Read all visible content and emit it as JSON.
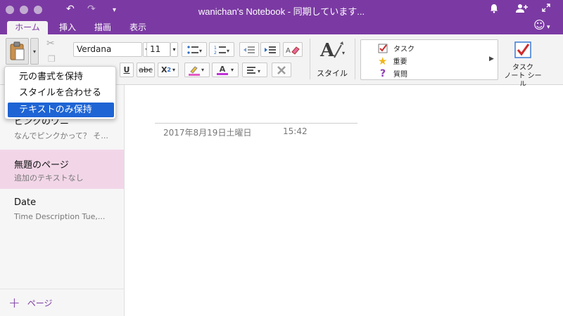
{
  "window": {
    "title": "wanichan's Notebook - 同期しています..."
  },
  "tabs": [
    {
      "label": "ホーム"
    },
    {
      "label": "挿入"
    },
    {
      "label": "描画"
    },
    {
      "label": "表示"
    }
  ],
  "ribbon": {
    "font_name": "Verdana",
    "font_size": "11",
    "underline_label": "U",
    "strike_label": "abc",
    "subscript_label": "X",
    "subscript_sub": "2",
    "font_color_label": "A",
    "style_label": "スタイル",
    "tags": [
      {
        "label": "タスク",
        "icon": "checkbox-icon"
      },
      {
        "label": "重要",
        "icon": "star-icon"
      },
      {
        "label": "質問",
        "icon": "question-icon"
      }
    ],
    "task_button_label_line1": "タスク",
    "task_button_label_line2": "ノート シール",
    "accent_color": "#7b3aa3"
  },
  "paste_menu": {
    "items": [
      {
        "label": "元の書式を保持"
      },
      {
        "label": "スタイルを合わせる"
      },
      {
        "label": "テキストのみ保持"
      }
    ],
    "selected_index": 2
  },
  "pages": [
    {
      "title": "ピンクのワニ",
      "subtitle": "なんでピンクかって？ そ..."
    },
    {
      "title": "無題のページ",
      "subtitle": "追加のテキストなし"
    },
    {
      "title": "Date",
      "subtitle": "Time  Description  Tue,..."
    }
  ],
  "selected_page_index": 1,
  "add_page_label": "ページ",
  "note": {
    "date": "2017年8月19日土曜日",
    "time": "15:42"
  }
}
